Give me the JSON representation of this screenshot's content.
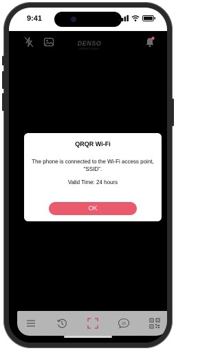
{
  "status_bar": {
    "time": "9:41",
    "icons": [
      "cellular-signal-icon",
      "wifi-icon",
      "battery-icon"
    ]
  },
  "app_bar": {
    "left_icons": [
      "flash-off-icon",
      "gallery-icon"
    ],
    "logo": "DENSO",
    "logo_subtext": "DENSO WAVE",
    "right_icon": "notification-bell-icon",
    "notification_badge_color": "#e85a6c"
  },
  "dialog": {
    "title": "QRQR Wi-Fi",
    "message": "The phone is connected to the Wi-Fi access point, \"SSID\".",
    "valid_time": "Valid Time: 24 hours",
    "ok_label": "OK"
  },
  "tab_bar": {
    "tabs": [
      {
        "icon": "menu-icon"
      },
      {
        "icon": "history-icon"
      },
      {
        "icon": "scan-icon",
        "active": true
      },
      {
        "icon": "chat-icon",
        "label": "ch"
      },
      {
        "icon": "my-qr-icon"
      }
    ]
  },
  "colors": {
    "accent": "#e85a6c",
    "overlay": "#000000",
    "tab_bar_bg": "#b5b5b5"
  }
}
